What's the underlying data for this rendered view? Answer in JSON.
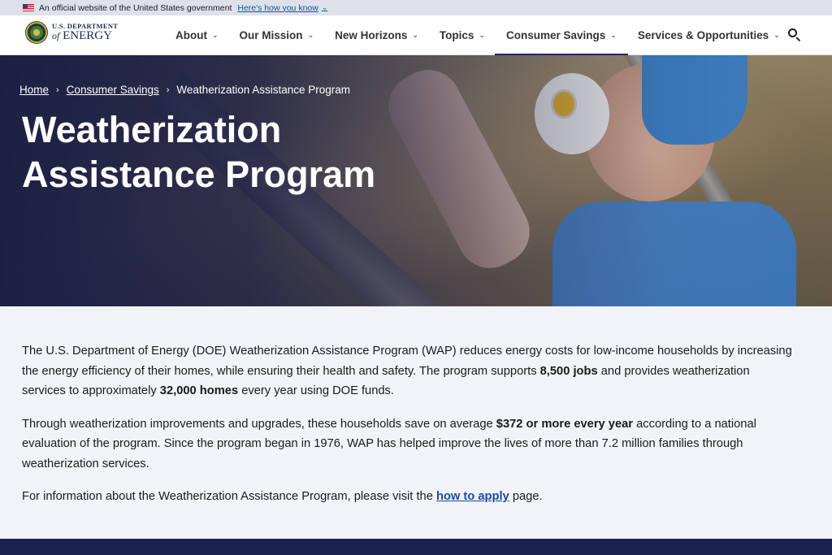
{
  "gov_banner": {
    "text": "An official website of the United States government",
    "link": "Here's how you know"
  },
  "logo": {
    "top": "U.S. DEPARTMENT",
    "of": "of",
    "bottom": "ENERGY"
  },
  "nav": {
    "items": [
      {
        "label": "About"
      },
      {
        "label": "Our Mission"
      },
      {
        "label": "New Horizons"
      },
      {
        "label": "Topics"
      },
      {
        "label": "Consumer Savings",
        "active": true
      },
      {
        "label": "Services & Opportunities"
      }
    ]
  },
  "breadcrumb": {
    "home": "Home",
    "parent": "Consumer Savings",
    "current": "Weatherization Assistance Program"
  },
  "hero": {
    "title": "Weatherization Assistance Program"
  },
  "content": {
    "p1_a": "The U.S. Department of Energy (DOE) Weatherization Assistance Program (WAP) reduces energy costs for low-income households by increasing the energy efficiency of their homes, while ensuring their health and safety. The program supports ",
    "p1_b": "8,500 jobs",
    "p1_c": " and provides weatherization services to approximately ",
    "p1_d": "32,000 homes",
    "p1_e": " every year using DOE funds.",
    "p2_a": "Through weatherization improvements and upgrades, these households save on average ",
    "p2_b": "$372 or more every year",
    "p2_c": " according to a national evaluation of the program. Since the program began in 1976, WAP has helped improve the lives of more than 7.2 million families through weatherization services.",
    "p3_a": "For information about the Weatherization Assistance Program, please visit the ",
    "p3_link": "how to apply",
    "p3_b": " page."
  },
  "colors": {
    "navy": "#1b2150",
    "link": "#1b4b9e",
    "gov_link": "#005ea2"
  }
}
